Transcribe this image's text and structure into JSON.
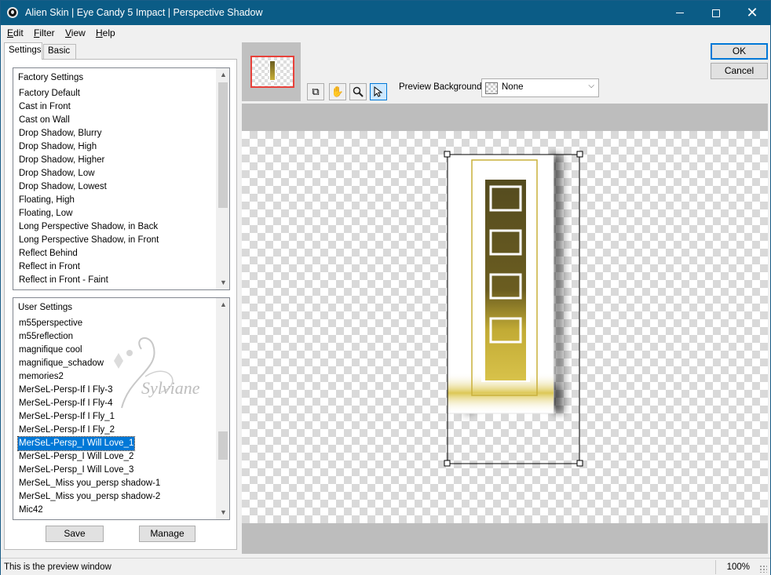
{
  "window": {
    "title": "Alien Skin | Eye Candy 5 Impact | Perspective Shadow",
    "minimize_icon": "minimize-icon",
    "maximize_icon": "maximize-icon",
    "close_icon": "close-icon"
  },
  "menu": [
    {
      "label": "Edit",
      "mnemonic": "E",
      "rest": "dit"
    },
    {
      "label": "Filter",
      "mnemonic": "F",
      "rest": "ilter"
    },
    {
      "label": "View",
      "mnemonic": "V",
      "rest": "iew"
    },
    {
      "label": "Help",
      "mnemonic": "H",
      "rest": "elp"
    }
  ],
  "tabs": [
    {
      "label": "Settings",
      "active": true
    },
    {
      "label": "Basic",
      "active": false
    }
  ],
  "factory_settings": {
    "header": "Factory Settings",
    "items": [
      "Factory Default",
      "Cast in Front",
      "Cast on Wall",
      "Drop Shadow, Blurry",
      "Drop Shadow, High",
      "Drop Shadow, Higher",
      "Drop Shadow, Low",
      "Drop Shadow, Lowest",
      "Floating, High",
      "Floating, Low",
      "Long Perspective Shadow, in Back",
      "Long Perspective Shadow, in Front",
      "Reflect Behind",
      "Reflect in Front",
      "Reflect in Front - Faint"
    ]
  },
  "user_settings": {
    "header": "User Settings",
    "items": [
      "m55perspective",
      "m55reflection",
      "magnifique cool",
      "magnifique_schadow",
      "memories2",
      "MerSeL-Persp-If I Fly-3",
      "MerSeL-Persp-If I Fly-4",
      "MerSeL-Persp-If I Fly_1",
      "MerSeL-Persp-If I Fly_2",
      "MerSeL-Persp_I Will Love_1",
      "MerSeL-Persp_I Will Love_2",
      "MerSeL-Persp_I Will Love_3",
      "MerSeL_Miss you_persp shadow-1",
      "MerSeL_Miss you_persp shadow-2",
      "Mic42"
    ],
    "selected_index": 9
  },
  "buttons": {
    "save": "Save",
    "manage": "Manage",
    "ok": "OK",
    "cancel": "Cancel"
  },
  "toolbar": {
    "tools": [
      "view-original-icon",
      "hand-icon",
      "zoom-icon",
      "arrow-pointer-icon"
    ]
  },
  "preview_background": {
    "label": "Preview Background:",
    "value": "None"
  },
  "watermark": {
    "text": "Sylviane"
  },
  "status": {
    "text": "This is the preview window",
    "zoom": "100%"
  },
  "colors": {
    "titlebar": "#0b5c86",
    "selection": "#0078d7",
    "preview_frame_gold": "#c9b03a",
    "preview_frame_dark": "#4a4420"
  }
}
